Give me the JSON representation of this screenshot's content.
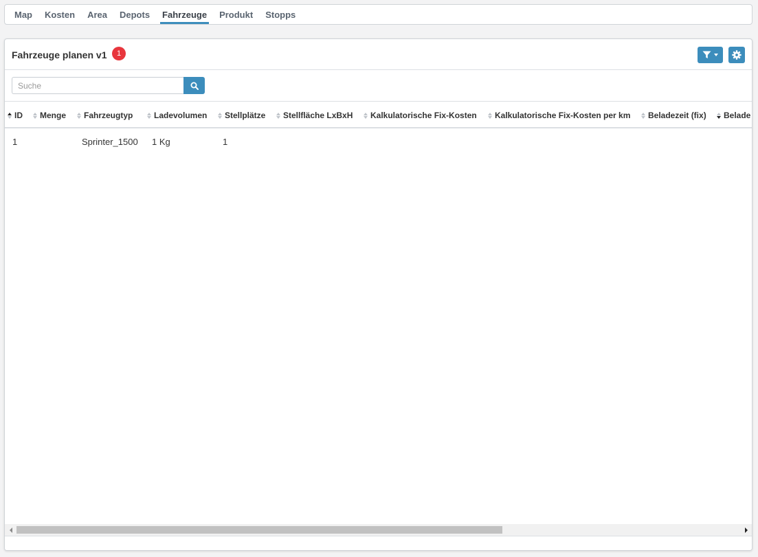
{
  "nav": {
    "tabs": [
      {
        "label": "Map"
      },
      {
        "label": "Kosten"
      },
      {
        "label": "Area"
      },
      {
        "label": "Depots"
      },
      {
        "label": "Fahrzeuge",
        "active": true
      },
      {
        "label": "Produkt"
      },
      {
        "label": "Stopps"
      }
    ]
  },
  "panel": {
    "title": "Fahrzeuge planen v1",
    "badge": "1",
    "filter_icon": "filter-icon",
    "settings_icon": "gear-icon"
  },
  "search": {
    "placeholder": "Suche",
    "value": "",
    "icon": "search-icon"
  },
  "table": {
    "columns": [
      {
        "label": "ID",
        "sort": "asc"
      },
      {
        "label": "Menge",
        "sort": "none"
      },
      {
        "label": "Fahrzeugtyp",
        "sort": "none"
      },
      {
        "label": "Ladevolumen",
        "sort": "none"
      },
      {
        "label": "Stellplätze",
        "sort": "none"
      },
      {
        "label": "Stellfläche LxBxH",
        "sort": "none"
      },
      {
        "label": "Kalkulatorische Fix-Kosten",
        "sort": "none"
      },
      {
        "label": "Kalkulatorische Fix-Kosten per km",
        "sort": "none"
      },
      {
        "label": "Beladezeit (fix)",
        "sort": "none"
      },
      {
        "label": "Belade",
        "sort": "desc"
      }
    ],
    "rows": [
      [
        "1",
        "",
        "Sprinter_1500",
        "1 Kg",
        "1",
        "",
        "",
        "",
        "",
        ""
      ]
    ]
  },
  "colors": {
    "accent": "#3c8dbc",
    "badge": "#e8363d"
  }
}
